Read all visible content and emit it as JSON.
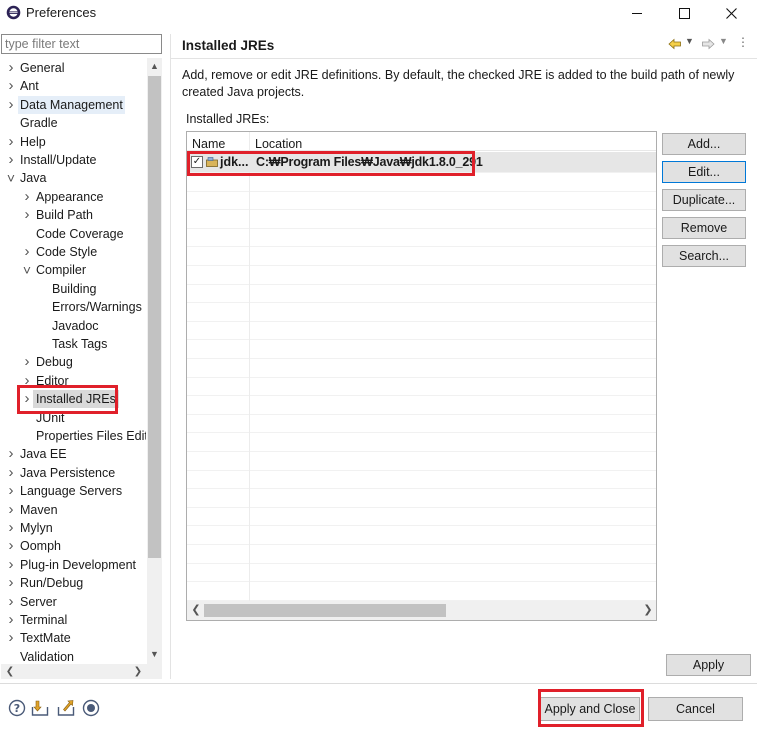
{
  "window": {
    "title": "Preferences"
  },
  "filter": {
    "placeholder": "type filter text",
    "value": ""
  },
  "tree": {
    "items": [
      {
        "label": "General",
        "expander": "collapsed"
      },
      {
        "label": "Ant",
        "expander": "collapsed"
      },
      {
        "label": "Data Management",
        "expander": "collapsed",
        "state": "highlighted"
      },
      {
        "label": "Gradle",
        "expander": "none"
      },
      {
        "label": "Help",
        "expander": "collapsed"
      },
      {
        "label": "Install/Update",
        "expander": "collapsed"
      },
      {
        "label": "Java",
        "expander": "expanded"
      },
      {
        "label": "Appearance",
        "expander": "collapsed"
      },
      {
        "label": "Build Path",
        "expander": "collapsed"
      },
      {
        "label": "Code Coverage",
        "expander": "none"
      },
      {
        "label": "Code Style",
        "expander": "collapsed"
      },
      {
        "label": "Compiler",
        "expander": "expanded"
      },
      {
        "label": "Building",
        "expander": "none"
      },
      {
        "label": "Errors/Warnings",
        "expander": "none"
      },
      {
        "label": "Javadoc",
        "expander": "none"
      },
      {
        "label": "Task Tags",
        "expander": "none"
      },
      {
        "label": "Debug",
        "expander": "collapsed"
      },
      {
        "label": "Editor",
        "expander": "collapsed"
      },
      {
        "label": "Installed JREs",
        "expander": "collapsed",
        "state": "selected"
      },
      {
        "label": "JUnit",
        "expander": "none"
      },
      {
        "label": "Properties Files Edito",
        "expander": "none"
      },
      {
        "label": "Java EE",
        "expander": "collapsed"
      },
      {
        "label": "Java Persistence",
        "expander": "collapsed"
      },
      {
        "label": "Language Servers",
        "expander": "collapsed"
      },
      {
        "label": "Maven",
        "expander": "collapsed"
      },
      {
        "label": "Mylyn",
        "expander": "collapsed"
      },
      {
        "label": "Oomph",
        "expander": "collapsed"
      },
      {
        "label": "Plug-in Development",
        "expander": "collapsed"
      },
      {
        "label": "Run/Debug",
        "expander": "collapsed"
      },
      {
        "label": "Server",
        "expander": "collapsed"
      },
      {
        "label": "Terminal",
        "expander": "collapsed"
      },
      {
        "label": "TextMate",
        "expander": "collapsed"
      },
      {
        "label": "Validation",
        "expander": "none"
      }
    ]
  },
  "page": {
    "title": "Installed JREs",
    "description": "Add, remove or edit JRE definitions. By default, the checked JRE is added to the build path of newly created Java projects.",
    "installed_label": "Installed JREs:"
  },
  "table": {
    "columns": [
      "Name",
      "Location"
    ],
    "rows": [
      {
        "checked": true,
        "name": "jdk...",
        "location": "C:₩Program Files₩Java₩jdk1.8.0_291"
      }
    ]
  },
  "buttons": {
    "add": "Add...",
    "edit": "Edit...",
    "duplicate": "Duplicate...",
    "remove": "Remove",
    "search": "Search...",
    "apply": "Apply",
    "apply_close": "Apply and Close",
    "cancel": "Cancel"
  },
  "colors": {
    "annotation_red": "#e0202a",
    "selection_gray": "#d9d9d9",
    "focus_blue": "#0078d7"
  },
  "icons": {
    "bottom": [
      "help-icon",
      "import-icon",
      "export-icon",
      "record-icon"
    ],
    "nav": [
      "back-icon",
      "back-menu-icon",
      "forward-icon",
      "forward-menu-icon",
      "more-icon"
    ]
  }
}
